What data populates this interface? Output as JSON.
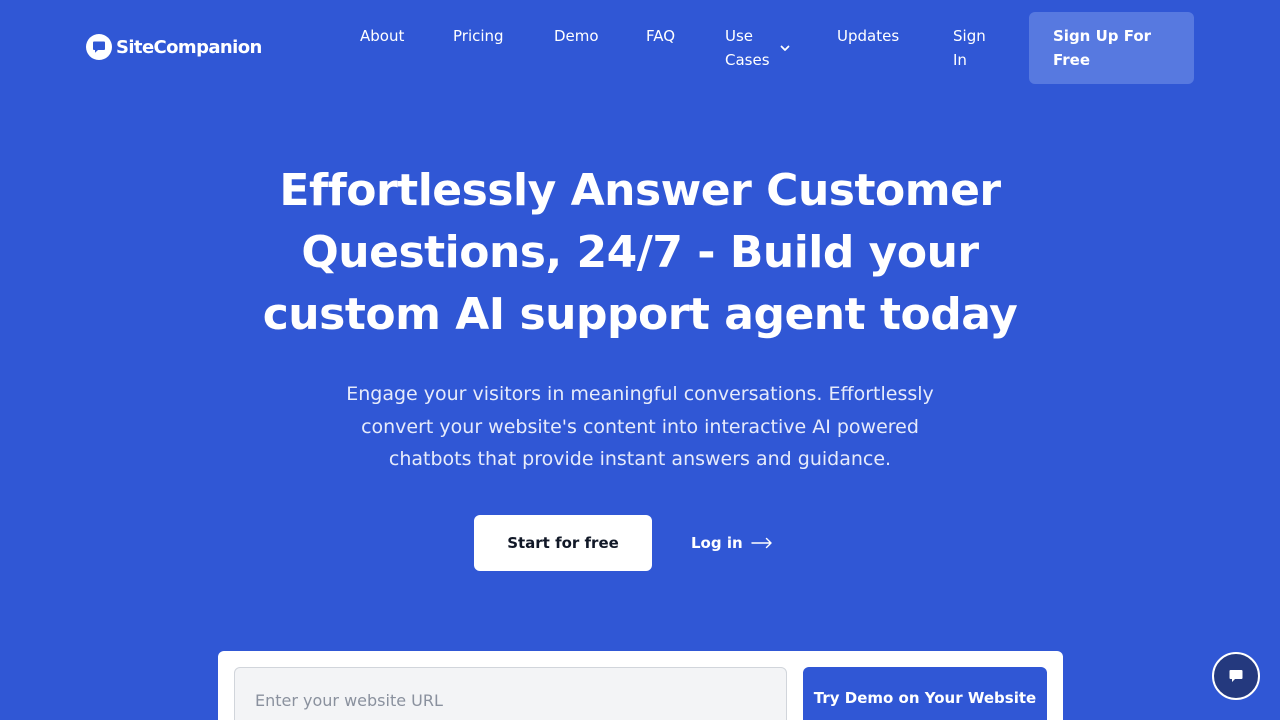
{
  "brand": {
    "name": "SiteCompanion",
    "logo_icon": "chat-bubble-icon"
  },
  "nav": {
    "about": "About",
    "pricing": "Pricing",
    "demo": "Demo",
    "faq": "FAQ",
    "use_cases": "Use Cases",
    "use_cases_icon": "chevron-down-icon",
    "updates": "Updates",
    "sign_in": "Sign In",
    "sign_up": "Sign Up For Free"
  },
  "hero": {
    "title": "Effortlessly Answer Customer Questions, 24/7 - Build your custom AI support agent today",
    "subtitle": "Engage your visitors in meaningful conversations. Effortlessly convert your website's content into interactive AI powered chatbots that provide instant answers and guidance.",
    "start_label": "Start for free",
    "login_label": "Log in",
    "login_icon": "arrow-right-icon"
  },
  "demo": {
    "url_placeholder": "Enter your website URL",
    "url_value": "",
    "button_label": "Try Demo on Your Website"
  },
  "chat_widget": {
    "icon": "chat-bubble-icon"
  },
  "colors": {
    "background": "#3057d5",
    "signup_button": "#5779e0",
    "chat_widget": "#24397e",
    "white": "#ffffff"
  }
}
